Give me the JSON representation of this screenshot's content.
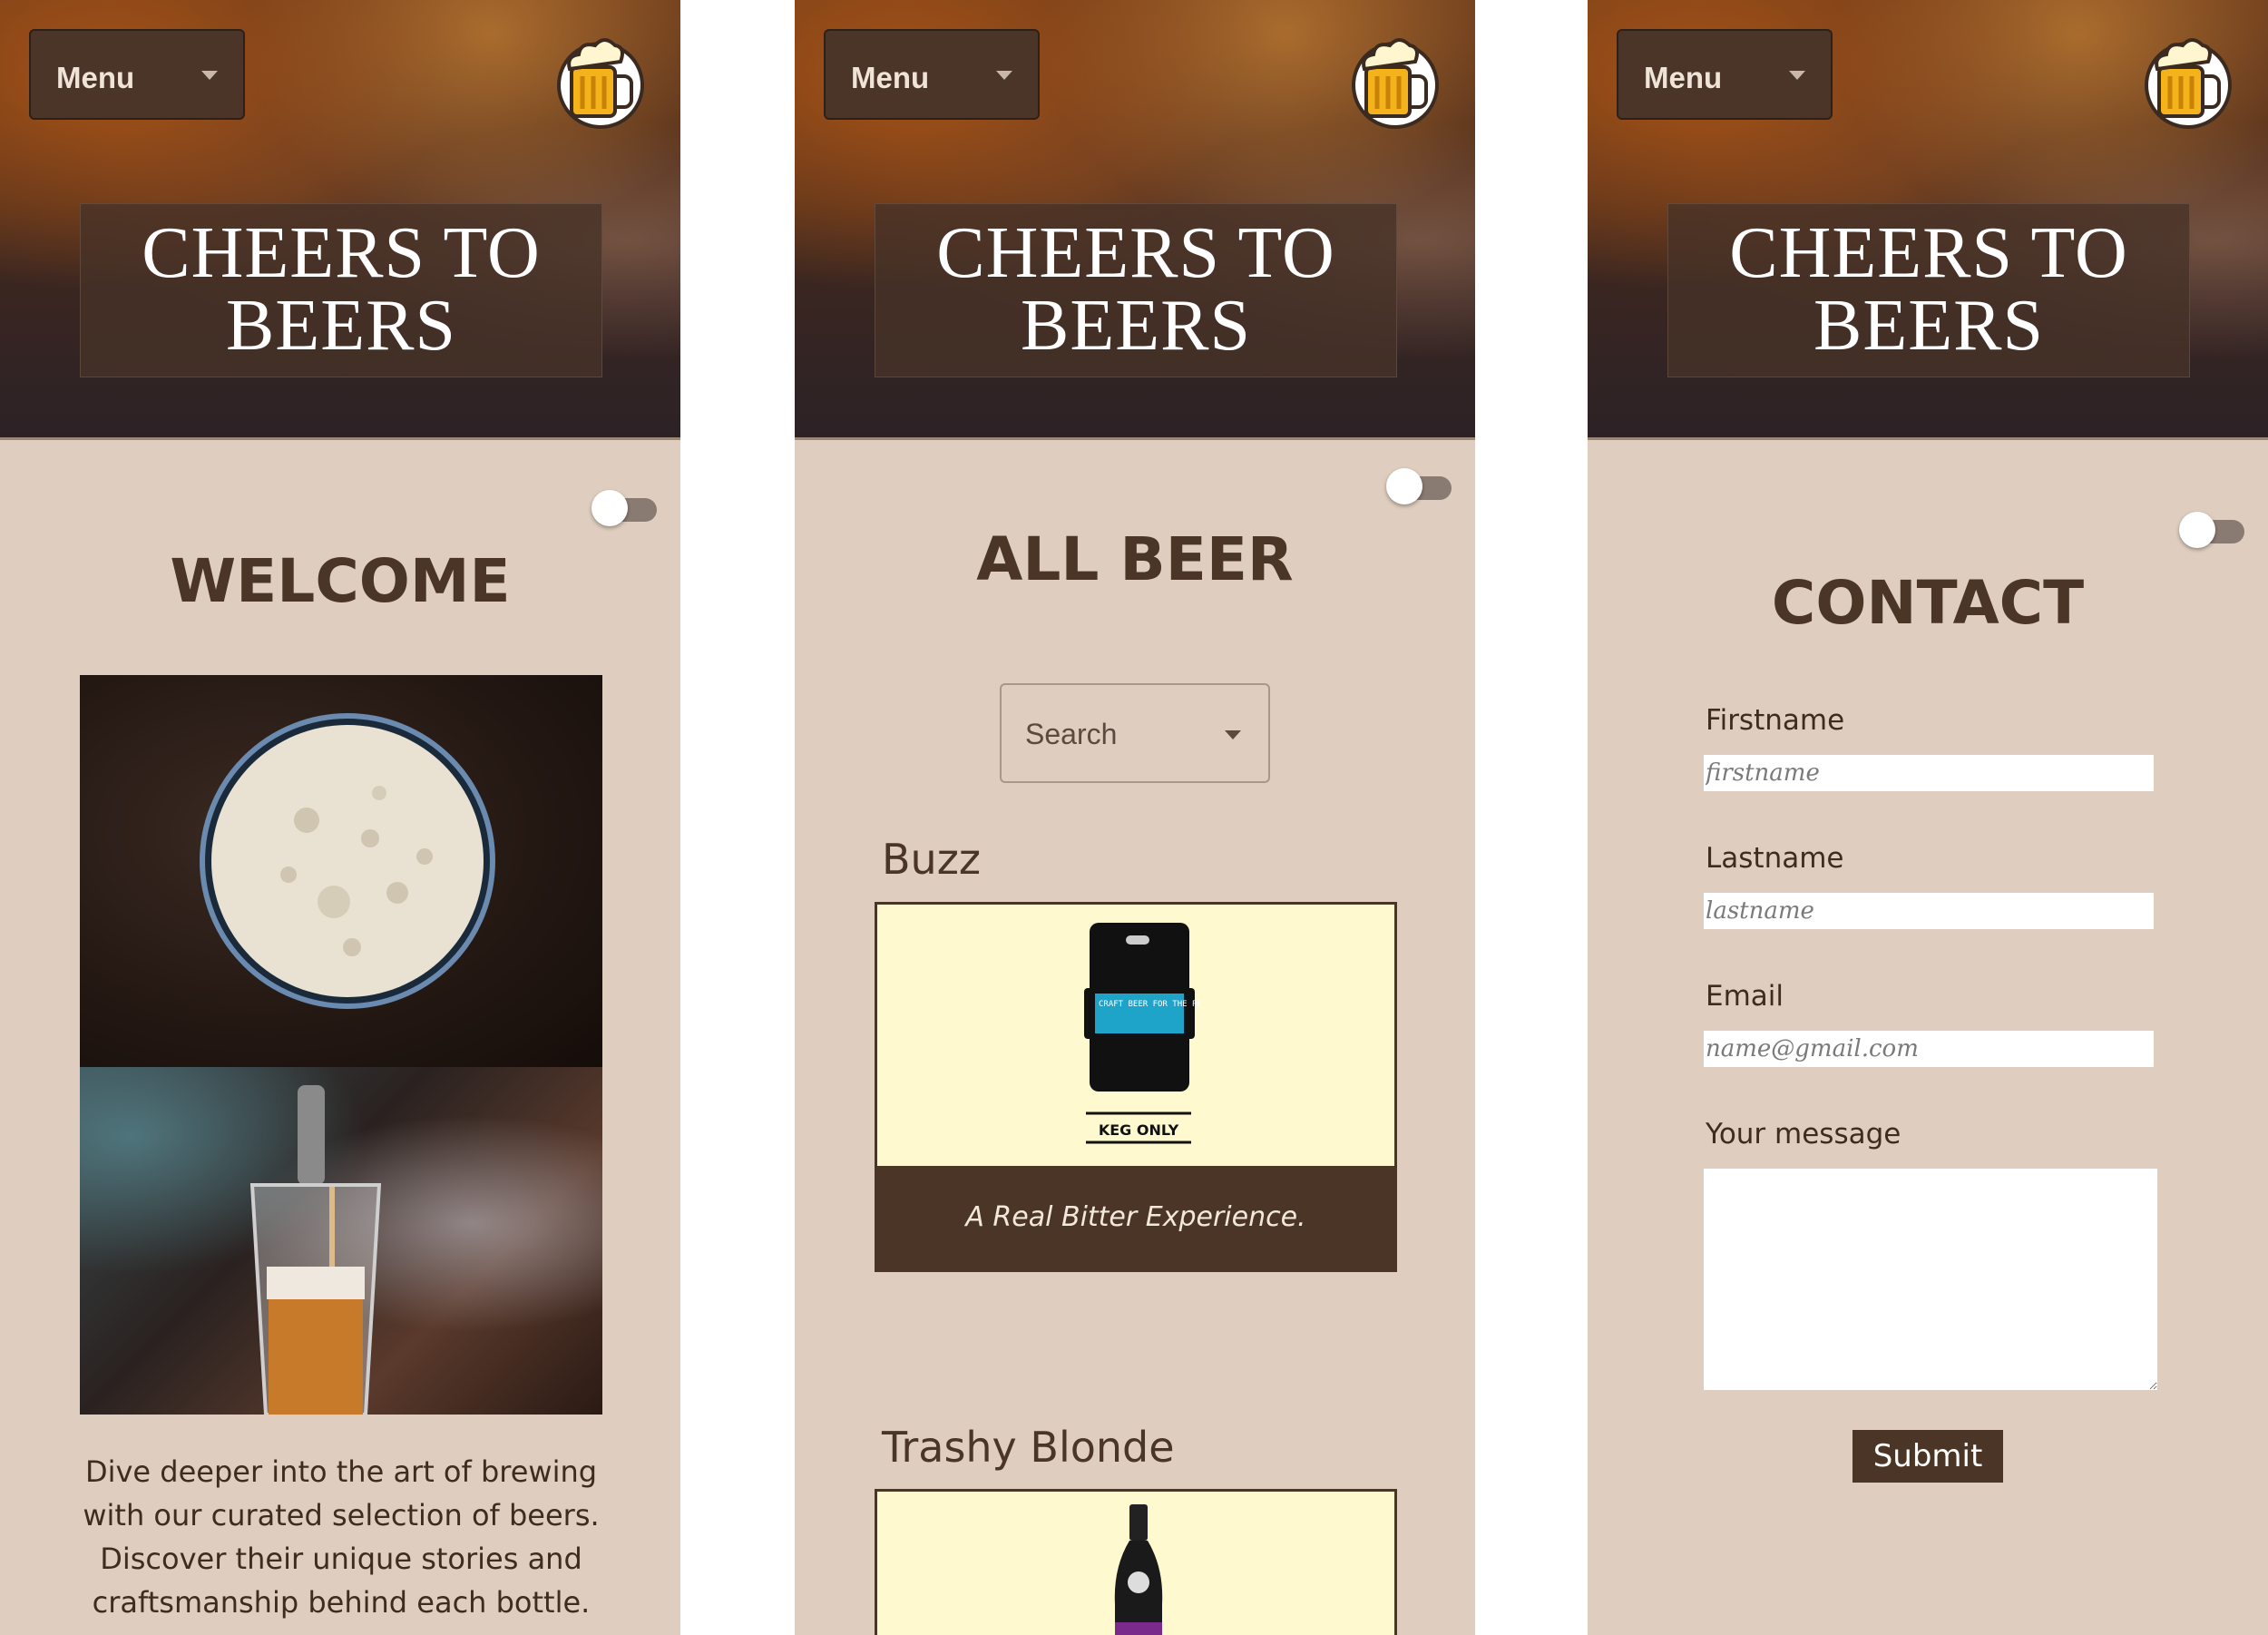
{
  "header": {
    "menu_label": "Menu",
    "title": "CHEERS TO BEERS"
  },
  "home": {
    "heading": "WELCOME",
    "description": "Dive deeper into the art of brewing with our curated selection of beers. Discover their unique stories and craftsmanship behind each bottle."
  },
  "catalog": {
    "heading": "ALL BEER",
    "search_label": "Search",
    "beers": [
      {
        "name": "Buzz",
        "tagline": "A Real Bitter Experience.",
        "keg_label": "KEG ONLY",
        "keg_text": "CRAFT BEER FOR THE PEOPLE"
      },
      {
        "name": "Trashy Blonde"
      }
    ]
  },
  "contact": {
    "heading": "CONTACT",
    "firstname_label": "Firstname",
    "firstname_placeholder": "firstname",
    "lastname_label": "Lastname",
    "lastname_placeholder": "lastname",
    "email_label": "Email",
    "email_placeholder": "name@gmail.com",
    "message_label": "Your message",
    "submit_label": "Submit"
  },
  "colors": {
    "page_background": "#dfcebf",
    "accent_brown": "#4a3526",
    "card_background": "#fff9d0",
    "logo_yellow": "#f5b31b"
  },
  "icons": {
    "logo": "beer-mug-icon",
    "menu_caret": "caret-down-icon",
    "search_caret": "caret-down-icon"
  }
}
